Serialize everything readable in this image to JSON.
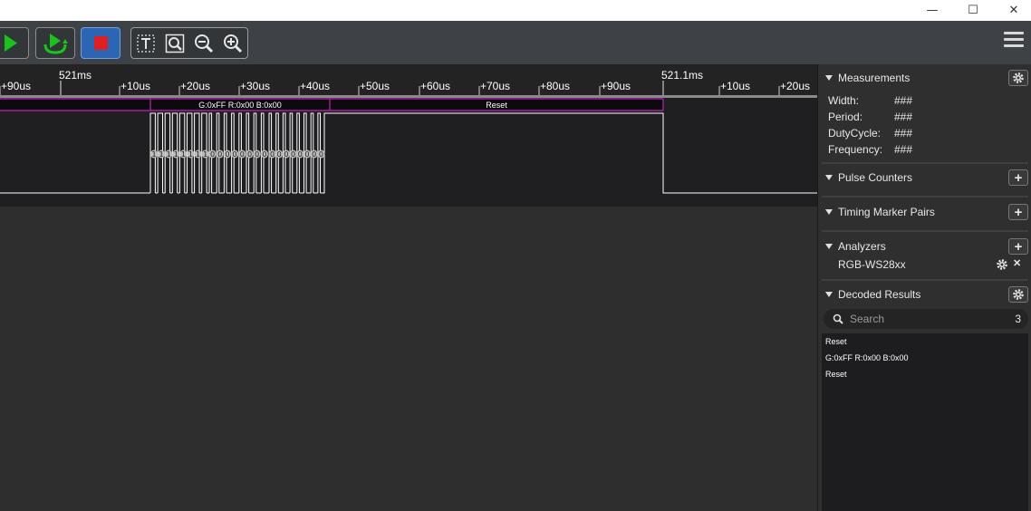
{
  "window": {
    "minimize_glyph": "—",
    "maximize_glyph": "☐",
    "close_glyph": "✕"
  },
  "toolbar": {
    "icons": [
      "play-icon",
      "loop-icon",
      "stop-icon",
      "text-cursor-icon",
      "zoom-fit-icon",
      "zoom-out-icon",
      "zoom-in-icon",
      "menu-icon"
    ],
    "colors": {
      "play": "#19c419",
      "stop": "#e02020",
      "stop_bg": "#2a66b3"
    }
  },
  "ruler": {
    "major_labels": [
      "521ms",
      "521.1ms"
    ],
    "tick_labels": [
      "+90us",
      "+10us",
      "+20us",
      "+30us",
      "+40us",
      "+50us",
      "+60us",
      "+70us",
      "+80us",
      "+90us",
      "+10us",
      "+20us"
    ]
  },
  "annotations": {
    "frames": [
      "G:0xFF R:0x00 B:0x00",
      "Reset"
    ],
    "bits_ones": "1",
    "bits_zeros": "0",
    "accent_color": "#c21fc2"
  },
  "sidebar": {
    "measurements": {
      "title": "Measurements",
      "rows": [
        {
          "label": "Width:",
          "value": "###"
        },
        {
          "label": "Period:",
          "value": "###"
        },
        {
          "label": "DutyCycle:",
          "value": "###"
        },
        {
          "label": "Frequency:",
          "value": "###"
        }
      ]
    },
    "pulse_counters": {
      "title": "Pulse Counters"
    },
    "timing_marker_pairs": {
      "title": "Timing Marker Pairs"
    },
    "analyzers": {
      "title": "Analyzers",
      "items": [
        {
          "name": "RGB-WS28xx"
        }
      ]
    },
    "decoded_results": {
      "title": "Decoded Results",
      "search_placeholder": "Search",
      "count": "3",
      "rows": [
        "Reset",
        "G:0xFF R:0x00 B:0x00",
        "Reset"
      ]
    },
    "add_glyph": "+",
    "remove_glyph": "✕"
  }
}
